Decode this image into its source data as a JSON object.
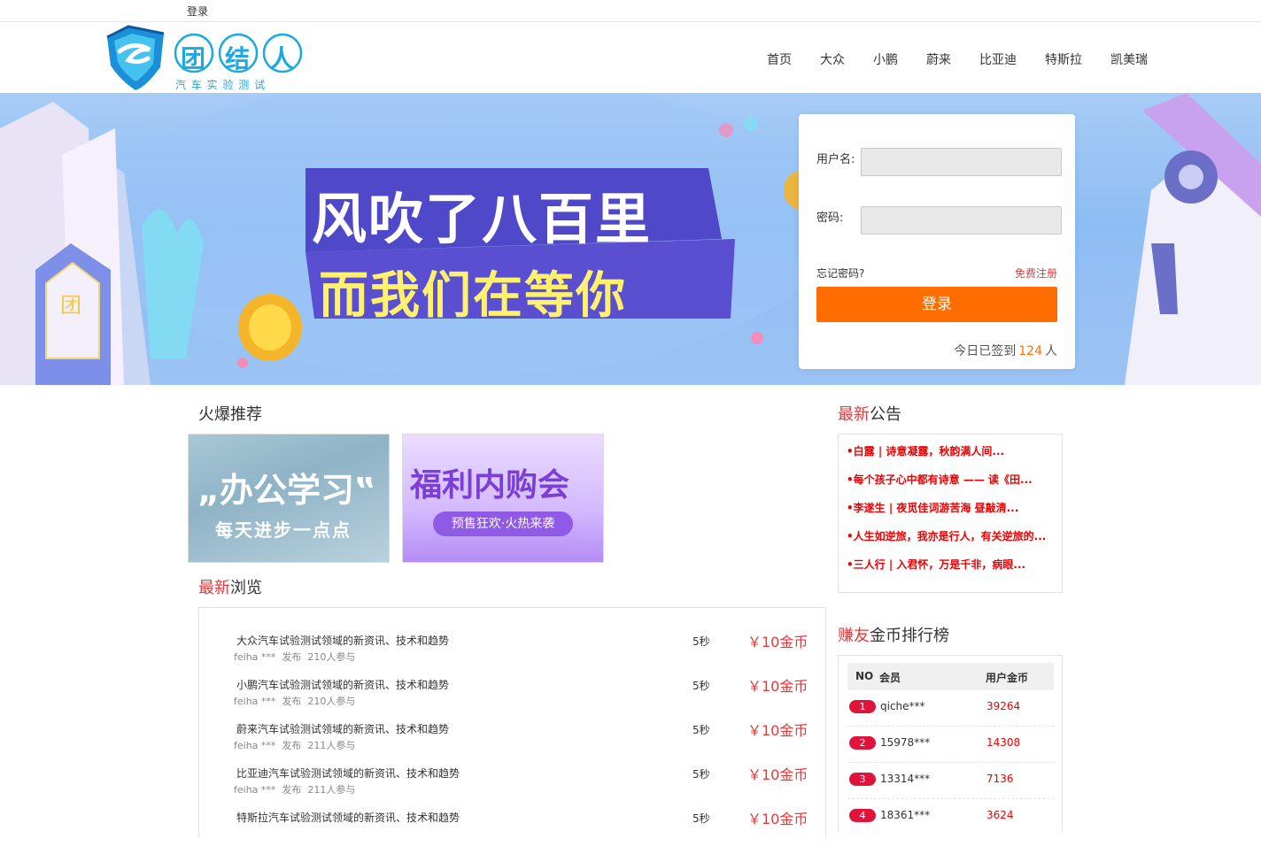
{
  "topbar": {
    "login_label": "登录"
  },
  "header": {
    "logo_text": "团结人",
    "logo_sub": "汽 车 实 验 测 试",
    "nav": [
      "首页",
      "大众",
      "小鹏",
      "蔚来",
      "比亚迪",
      "特斯拉",
      "凯美瑞"
    ]
  },
  "banner": {
    "line1": "风吹了八百里",
    "line2": "而我们在等你",
    "badge_char": "团"
  },
  "login": {
    "username_label": "用户名:",
    "password_label": "密码:",
    "forgot_label": "忘记密码?",
    "register_label": "免费注册",
    "submit_label": "登录",
    "signed_prefix": "今日已签到",
    "signed_count": "124",
    "signed_suffix": "人"
  },
  "hot": {
    "title": "火爆推荐",
    "promo1_title": "„办公学习‟",
    "promo1_sub": "每天进步一点点",
    "promo2_title": "福利内购会",
    "promo2_sub": "预售狂欢·火热来袭"
  },
  "browse": {
    "title_hl": "最新",
    "title_rest": "浏览",
    "items": [
      {
        "title": "大众汽车试验测试领域的新资讯、技术和趋势",
        "meta": "feiha ***  发布  210人参与",
        "time": "5秒",
        "price": "￥10金币"
      },
      {
        "title": "小鹏汽车试验测试领域的新资讯、技术和趋势",
        "meta": "feiha ***  发布  210人参与",
        "time": "5秒",
        "price": "￥10金币"
      },
      {
        "title": "蔚来汽车试验测试领域的新资讯、技术和趋势",
        "meta": "feiha ***  发布  211人参与",
        "time": "5秒",
        "price": "￥10金币"
      },
      {
        "title": "比亚迪汽车试验测试领域的新资讯、技术和趋势",
        "meta": "feiha ***  发布  211人参与",
        "time": "5秒",
        "price": "￥10金币"
      },
      {
        "title": "特斯拉汽车试验测试领域的新资讯、技术和趋势",
        "meta": "",
        "time": "5秒",
        "price": "￥10金币"
      }
    ]
  },
  "notice": {
    "title_hl": "最新",
    "title_rest": "公告",
    "items": [
      "•白露 | 诗意凝露，秋韵满人间...",
      "•每个孩子心中都有诗意 —— 读《田...",
      "•李遂生 | 夜觅佳词游苦海 昼敲清...",
      "•人生如逆旅，我亦是行人，有关逆旅的...",
      "•三人行 | 入君怀，万是千非，病眼..."
    ]
  },
  "rank": {
    "title_hl": "赚友",
    "title_rest": "金币排行榜",
    "col_no": "NO",
    "col_member": "会员",
    "col_coins": "用户金币",
    "rows": [
      {
        "no": "1",
        "member": "qiche***",
        "coins": "39264"
      },
      {
        "no": "2",
        "member": "15978***",
        "coins": "14308"
      },
      {
        "no": "3",
        "member": "13314***",
        "coins": "7136"
      },
      {
        "no": "4",
        "member": "18361***",
        "coins": "3624"
      }
    ]
  }
}
